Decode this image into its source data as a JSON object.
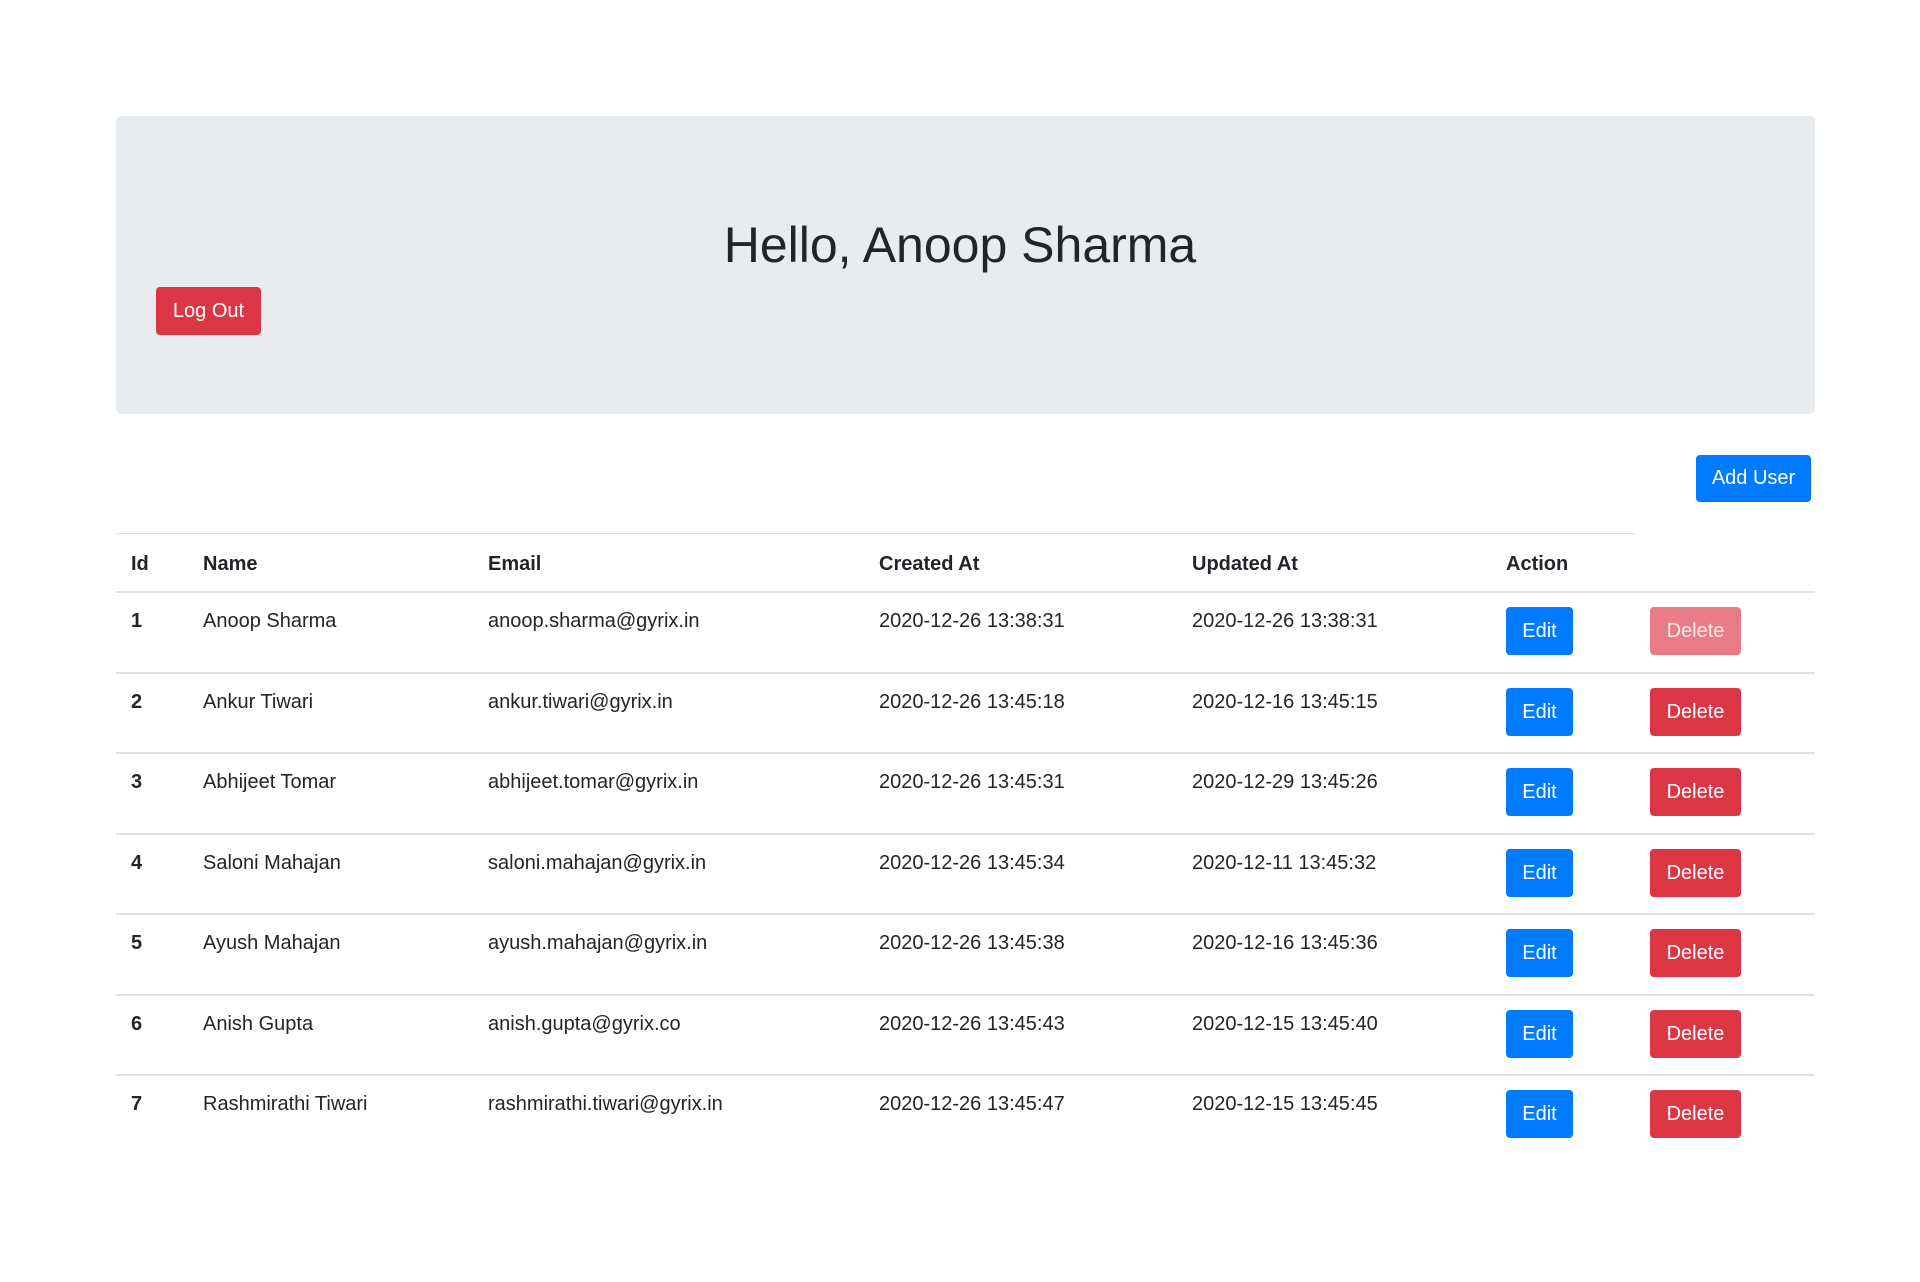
{
  "header": {
    "greeting": "Hello, Anoop Sharma",
    "logout_label": "Log Out"
  },
  "toolbar": {
    "add_user_label": "Add User"
  },
  "table": {
    "columns": [
      "Id",
      "Name",
      "Email",
      "Created At",
      "Updated At",
      "Action"
    ],
    "edit_label": "Edit",
    "delete_label": "Delete",
    "rows": [
      {
        "id": "1",
        "name": "Anoop Sharma",
        "email": "anoop.sharma@gyrix.in",
        "created_at": "2020-12-26 13:38:31",
        "updated_at": "2020-12-26 13:38:31",
        "delete_disabled": true
      },
      {
        "id": "2",
        "name": "Ankur Tiwari",
        "email": "ankur.tiwari@gyrix.in",
        "created_at": "2020-12-26 13:45:18",
        "updated_at": "2020-12-16 13:45:15",
        "delete_disabled": false
      },
      {
        "id": "3",
        "name": "Abhijeet Tomar",
        "email": "abhijeet.tomar@gyrix.in",
        "created_at": "2020-12-26 13:45:31",
        "updated_at": "2020-12-29 13:45:26",
        "delete_disabled": false
      },
      {
        "id": "4",
        "name": "Saloni Mahajan",
        "email": "saloni.mahajan@gyrix.in",
        "created_at": "2020-12-26 13:45:34",
        "updated_at": "2020-12-11 13:45:32",
        "delete_disabled": false
      },
      {
        "id": "5",
        "name": "Ayush Mahajan",
        "email": "ayush.mahajan@gyrix.in",
        "created_at": "2020-12-26 13:45:38",
        "updated_at": "2020-12-16 13:45:36",
        "delete_disabled": false
      },
      {
        "id": "6",
        "name": "Anish Gupta",
        "email": "anish.gupta@gyrix.co",
        "created_at": "2020-12-26 13:45:43",
        "updated_at": "2020-12-15 13:45:40",
        "delete_disabled": false
      },
      {
        "id": "7",
        "name": "Rashmirathi Tiwari",
        "email": "rashmirathi.tiwari@gyrix.in",
        "created_at": "2020-12-26 13:45:47",
        "updated_at": "2020-12-15 13:45:45",
        "delete_disabled": false
      }
    ]
  },
  "colors": {
    "primary": "#007bff",
    "danger": "#dc3545",
    "danger_disabled": "#e87d88",
    "jumbotron_bg": "#e9ecef",
    "border": "#dee2e6"
  }
}
